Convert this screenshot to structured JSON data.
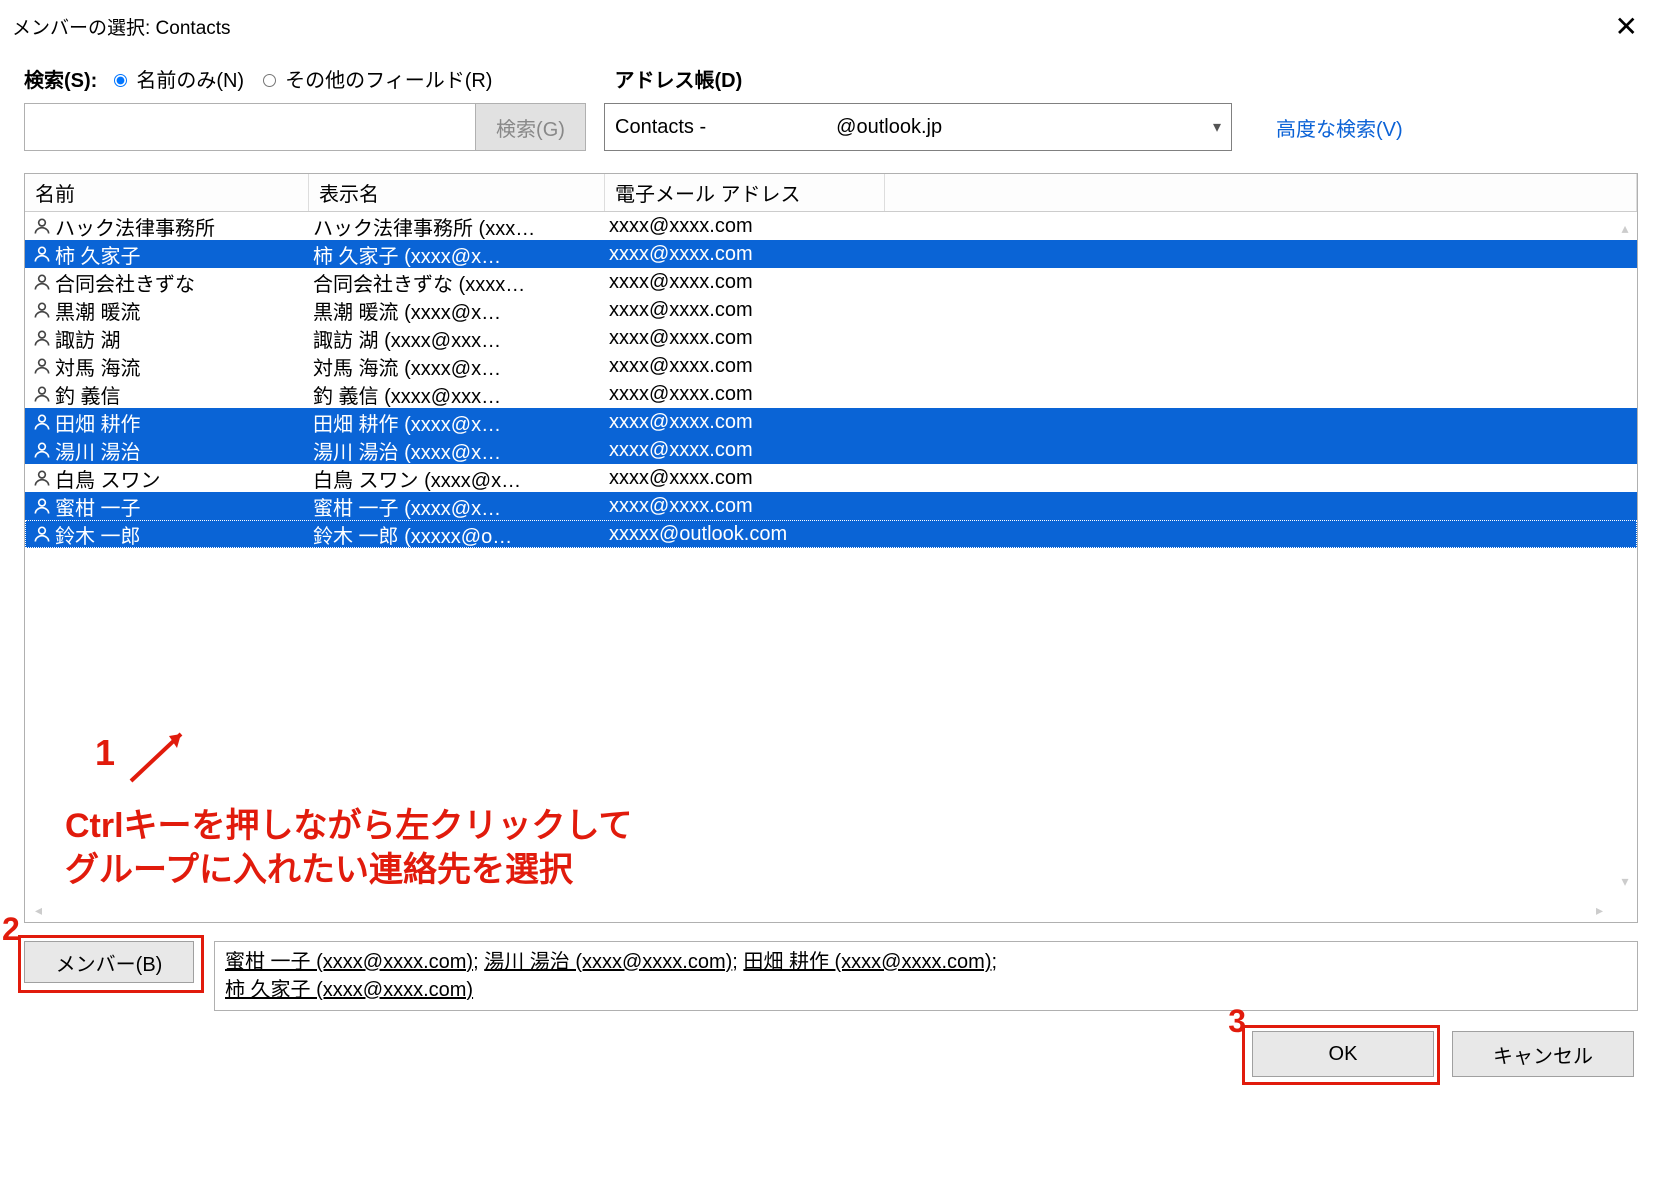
{
  "title": "メンバーの選択: Contacts",
  "search": {
    "label": "検索(S):",
    "radio_name_only": "名前のみ(N)",
    "radio_other": "その他のフィールド(R)",
    "address_book_label": "アドレス帳(D)",
    "search_button": "検索(G)",
    "search_value": "",
    "addr_prefix": "Contacts -",
    "addr_suffix": "@outlook.jp",
    "advanced": "高度な検索(V)"
  },
  "columns": {
    "name": "名前",
    "display": "表示名",
    "email": "電子メール アドレス"
  },
  "rows": [
    {
      "name": "ハック法律事務所",
      "display": "ハック法律事務所 (xxx…",
      "email": "xxxx@xxxx.com",
      "selected": false
    },
    {
      "name": "柿  久家子",
      "display": "柿  久家子 (xxxx@x…",
      "email": "xxxx@xxxx.com",
      "selected": true
    },
    {
      "name": "合同会社きずな",
      "display": "合同会社きずな (xxxx…",
      "email": "xxxx@xxxx.com",
      "selected": false
    },
    {
      "name": "黒潮  暖流",
      "display": "黒潮  暖流 (xxxx@x…",
      "email": "xxxx@xxxx.com",
      "selected": false
    },
    {
      "name": "諏訪  湖",
      "display": "諏訪  湖 (xxxx@xxx…",
      "email": "xxxx@xxxx.com",
      "selected": false
    },
    {
      "name": "対馬  海流",
      "display": "対馬  海流 (xxxx@x…",
      "email": "xxxx@xxxx.com",
      "selected": false
    },
    {
      "name": "釣  義信",
      "display": "釣  義信 (xxxx@xxx…",
      "email": "xxxx@xxxx.com",
      "selected": false
    },
    {
      "name": "田畑  耕作",
      "display": "田畑  耕作 (xxxx@x…",
      "email": "xxxx@xxxx.com",
      "selected": true
    },
    {
      "name": "湯川  湯治",
      "display": "湯川  湯治 (xxxx@x…",
      "email": "xxxx@xxxx.com",
      "selected": true
    },
    {
      "name": "白鳥  スワン",
      "display": "白鳥  スワン (xxxx@x…",
      "email": "xxxx@xxxx.com",
      "selected": false
    },
    {
      "name": "蜜柑  一子",
      "display": "蜜柑  一子 (xxxx@x…",
      "email": "xxxx@xxxx.com",
      "selected": true
    },
    {
      "name": "鈴木 一郎",
      "display": "鈴木 一郎 (xxxxx@o…",
      "email": "xxxxx@outlook.com",
      "selected": true,
      "focus": true
    }
  ],
  "members": {
    "button": "メンバー(B)",
    "items": [
      "蜜柑  一子 (xxxx@xxxx.com)",
      "湯川  湯治 (xxxx@xxxx.com)",
      "田畑  耕作 (xxxx@xxxx.com)",
      "柿  久家子 (xxxx@xxxx.com)"
    ]
  },
  "buttons": {
    "ok": "OK",
    "cancel": "キャンセル"
  },
  "annotations": {
    "n1": "1",
    "n2": "2",
    "n3": "3",
    "text_line1": "Ctrlキーを押しながら左クリックして",
    "text_line2": "グループに入れたい連絡先を選択"
  }
}
